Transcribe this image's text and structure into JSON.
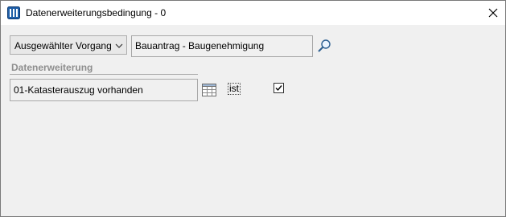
{
  "window": {
    "title": "Datenerweiterungsbedingung - 0"
  },
  "form": {
    "scope_select": {
      "selected": "Ausgewählter Vorgang"
    },
    "vorgang_field": {
      "value": "Bauantrag - Baugenehmigung"
    },
    "group": {
      "label": "Datenerweiterung"
    },
    "datenerweiterung_field": {
      "value": "01-Katasterauszug vorhanden"
    },
    "operator_label": "ist",
    "condition_checkbox": {
      "checked": true
    }
  },
  "icons": {
    "app": "app-icon",
    "close": "close-icon",
    "dropdown": "chevron-down-icon",
    "search": "search-icon",
    "table": "table-icon",
    "check": "checkmark-icon"
  }
}
